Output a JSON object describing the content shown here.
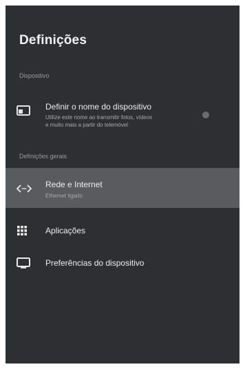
{
  "settings": {
    "title": "Definições",
    "section_devices": "Dispositivo",
    "device_name": {
      "title": "Definir o nome do dispositivo",
      "subtitle_line1": "Utilize este nome ao transmitir fotos, vídeos",
      "subtitle_line2": "e muito mais a partir do telemóvel",
      "icon": "cast-icon"
    },
    "section_general": "Definições gerais",
    "network": {
      "title": "Rede e Internet",
      "subtitle": "Ethernet ligado",
      "icon": "network-arrows-icon",
      "selected": true
    },
    "apps": {
      "title": "Aplicações",
      "icon": "apps-grid-icon"
    },
    "preferences": {
      "title": "Preferências do dispositivo",
      "icon": "tv-icon"
    }
  }
}
